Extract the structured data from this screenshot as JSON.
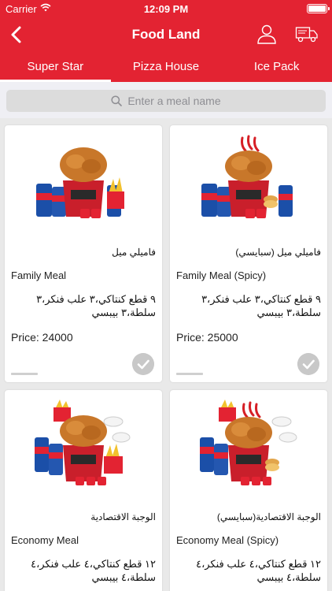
{
  "status_bar": {
    "carrier": "Carrier",
    "time": "12:09 PM"
  },
  "nav": {
    "title": "Food Land",
    "back_icon": "chevron-left-icon",
    "profile_icon": "user-icon",
    "delivery_icon": "truck-icon"
  },
  "tabs": [
    {
      "label": "Super Star",
      "active": true
    },
    {
      "label": "Pizza House",
      "active": false
    },
    {
      "label": "Ice Pack",
      "active": false
    }
  ],
  "search": {
    "placeholder": "Enter a meal name"
  },
  "colors": {
    "brand_red": "#e32332",
    "background": "#e9e9e9"
  },
  "meals": [
    {
      "name_ar": "فاميلي ميل",
      "name_en": "Family Meal",
      "desc_ar": "٩ قطع كنتاكي،٣ علب فنكر،٣ سلطة،٣ بيبسي",
      "price": "Price: 24000"
    },
    {
      "name_ar": "فاميلي ميل (سبايسي)",
      "name_en": "Family Meal (Spicy)",
      "desc_ar": "٩ قطع كنتاكي،٣ علب فنكر،٣ سلطة،٣ بيبسي",
      "price": "Price: 25000"
    },
    {
      "name_ar": "الوجبة الاقتصادية",
      "name_en": "Economy Meal",
      "desc_ar": "١٢ قطع كنتاكي،٤ علب فنكر،٤ سلطة،٤ بيبسي"
    },
    {
      "name_ar": "الوجبة الاقتصادية(سبايسي)",
      "name_en": "Economy Meal (Spicy)",
      "desc_ar": "١٢ قطع كنتاكي،٤ علب فنكر،٤ سلطة،٤ بيبسي"
    }
  ]
}
